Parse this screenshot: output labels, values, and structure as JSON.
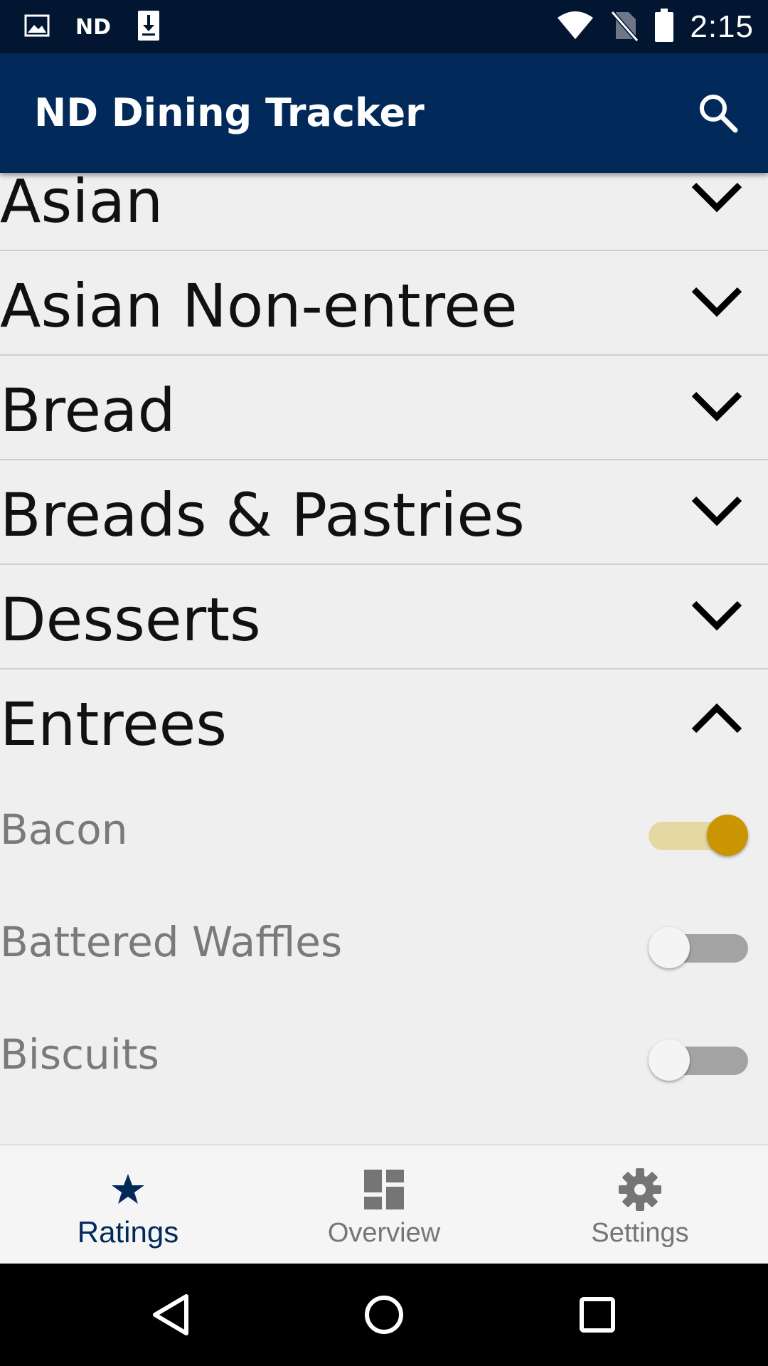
{
  "status_bar": {
    "time": "2:15",
    "left_icons": [
      "image-icon",
      "nd-logo-icon",
      "download-icon"
    ],
    "right_icons": [
      "wifi-icon",
      "no-sim-icon",
      "battery-icon"
    ],
    "nd_logo_text": "ND"
  },
  "app_bar": {
    "title": "ND Dining Tracker",
    "action_icon": "search-icon"
  },
  "categories": [
    {
      "label": "Asian",
      "expanded": false
    },
    {
      "label": "Asian Non-entree",
      "expanded": false
    },
    {
      "label": "Bread",
      "expanded": false
    },
    {
      "label": "Breads & Pastries",
      "expanded": false
    },
    {
      "label": "Desserts",
      "expanded": false
    },
    {
      "label": "Entrees",
      "expanded": true
    }
  ],
  "items": [
    {
      "label": "Bacon",
      "enabled": true
    },
    {
      "label": "Battered Waffles",
      "enabled": false
    },
    {
      "label": "Biscuits",
      "enabled": false
    }
  ],
  "bottom_nav": [
    {
      "label": "Ratings",
      "icon": "star-icon",
      "active": true
    },
    {
      "label": "Overview",
      "icon": "dashboard-icon",
      "active": false
    },
    {
      "label": "Settings",
      "icon": "gear-icon",
      "active": false
    }
  ],
  "colors": {
    "status_bar": "#021632",
    "app_bar": "#01295a",
    "accent_gold": "#c99500",
    "toggle_on_track": "#e5d9a3",
    "toggle_off_track": "#a3a3a3",
    "background": "#efefef"
  }
}
